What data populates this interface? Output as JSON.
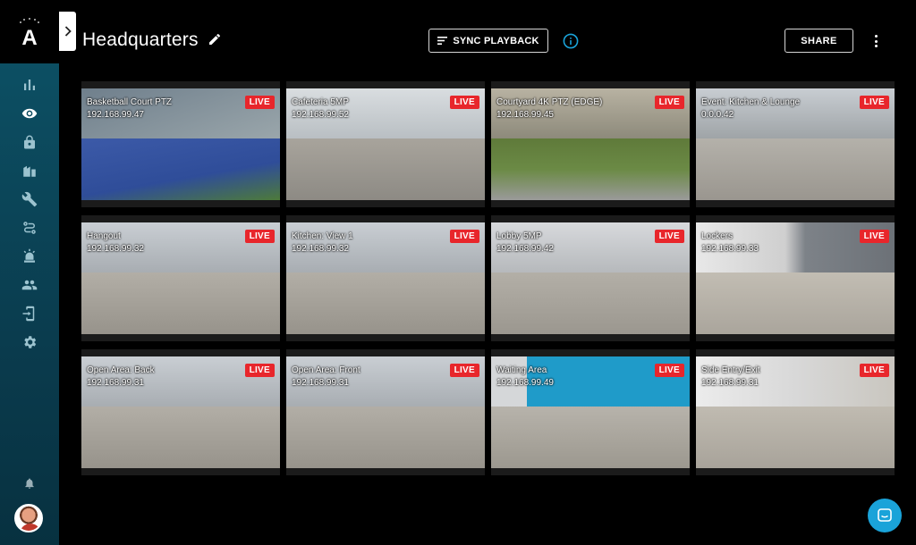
{
  "app": {
    "brand_letter": "A",
    "page_title": "Headquarters",
    "accent": "#1aa3d9",
    "live_color": "#e8262b"
  },
  "header": {
    "sync_label": "SYNC PLAYBACK",
    "share_label": "SHARE"
  },
  "sidebar": {
    "items": [
      {
        "icon": "bar-chart-icon",
        "active": false
      },
      {
        "icon": "eye-icon",
        "active": true
      },
      {
        "icon": "lock-icon",
        "active": false
      },
      {
        "icon": "buildings-icon",
        "active": false
      },
      {
        "icon": "wrench-icon",
        "active": false
      },
      {
        "icon": "route-icon",
        "active": false
      },
      {
        "icon": "alarm-icon",
        "active": false
      },
      {
        "icon": "people-icon",
        "active": false
      },
      {
        "icon": "device-transfer-icon",
        "active": false
      },
      {
        "icon": "gear-icon",
        "active": false
      }
    ]
  },
  "cameras": [
    {
      "name": "Basketball Court PTZ",
      "ip": "192.168.99.47",
      "status": "LIVE",
      "scene": "court"
    },
    {
      "name": "Cafeteria 5MP",
      "ip": "192.168.99.52",
      "status": "LIVE",
      "scene": "cafeteria"
    },
    {
      "name": "Courtyard 4K PTZ (EDGE)",
      "ip": "192.168.99.45",
      "status": "LIVE",
      "scene": "courtyard"
    },
    {
      "name": "Event: Kitchen & Lounge",
      "ip": "0.0.0.42",
      "status": "LIVE",
      "scene": "kitchen"
    },
    {
      "name": "Hangout",
      "ip": "192.168.99.32",
      "status": "LIVE",
      "scene": "office"
    },
    {
      "name": "Kitchen: View 1",
      "ip": "192.168.99.32",
      "status": "LIVE",
      "scene": "office"
    },
    {
      "name": "Lobby 5MP",
      "ip": "192.168.99.42",
      "status": "LIVE",
      "scene": "lobby"
    },
    {
      "name": "Lockers",
      "ip": "192.168.99.33",
      "status": "LIVE",
      "scene": "lockers"
    },
    {
      "name": "Open Area: Back",
      "ip": "192.168.99.31",
      "status": "LIVE",
      "scene": "office"
    },
    {
      "name": "Open Area: Front",
      "ip": "192.168.99.31",
      "status": "LIVE",
      "scene": "office"
    },
    {
      "name": "Waiting Area",
      "ip": "192.168.99.49",
      "status": "LIVE",
      "scene": "waiting"
    },
    {
      "name": "Side Entry/Exit",
      "ip": "192.168.99.31",
      "status": "LIVE",
      "scene": "entry"
    }
  ]
}
